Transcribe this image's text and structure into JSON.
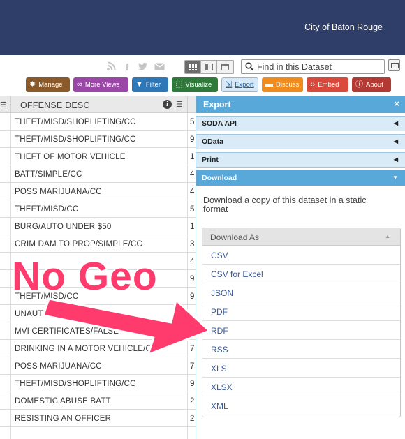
{
  "header": {
    "site_name": "City of Baton Rouge"
  },
  "toolbar": {
    "social": [
      "rss-icon",
      "facebook-icon",
      "twitter-icon",
      "email-icon"
    ],
    "search_placeholder": "Find in this Dataset",
    "buttons": {
      "manage": "Manage",
      "more_views": "More Views",
      "filter": "Filter",
      "visualize": "Visualize",
      "export": "Export",
      "discuss": "Discuss",
      "embed": "Embed",
      "about": "About"
    }
  },
  "table": {
    "column_header": "OFFENSE DESC",
    "rows": [
      {
        "offense": "THEFT/MISD/SHOPLIFTING/CC",
        "next": "5"
      },
      {
        "offense": "THEFT/MISD/SHOPLIFTING/CC",
        "next": "9"
      },
      {
        "offense": "THEFT OF MOTOR VEHICLE",
        "next": "1"
      },
      {
        "offense": "BATT/SIMPLE/CC",
        "next": "4"
      },
      {
        "offense": "POSS MARIJUANA/CC",
        "next": "4"
      },
      {
        "offense": "THEFT/MISD/CC",
        "next": "5"
      },
      {
        "offense": "BURG/AUTO UNDER $50",
        "next": "1"
      },
      {
        "offense": "CRIM DAM TO PROP/SIMPLE/CC",
        "next": "3"
      },
      {
        "offense": "",
        "next": "4"
      },
      {
        "offense": "",
        "next": "9"
      },
      {
        "offense": "THEFT/MISD/CC",
        "next": "9"
      },
      {
        "offense": "UNAUTH USE/MOVABLE",
        "next": ""
      },
      {
        "offense": "MVI CERTIFICATES/FALSE",
        "next": "7"
      },
      {
        "offense": "DRINKING IN A MOTOR VEHICLE/CC",
        "next": "7"
      },
      {
        "offense": "POSS MARIJUANA/CC",
        "next": "7"
      },
      {
        "offense": "THEFT/MISD/SHOPLIFTING/CC",
        "next": "9"
      },
      {
        "offense": "DOMESTIC ABUSE BATT",
        "next": "2"
      },
      {
        "offense": "RESISTING AN OFFICER",
        "next": "2"
      }
    ]
  },
  "export_panel": {
    "title": "Export",
    "close": "×",
    "sections": [
      "SODA API",
      "OData",
      "Print",
      "Download"
    ],
    "download_text": "Download a copy of this dataset in a static format",
    "download_as_label": "Download As",
    "formats": [
      "CSV",
      "CSV for Excel",
      "JSON",
      "PDF",
      "RDF",
      "RSS",
      "XLS",
      "XLSX",
      "XML"
    ]
  },
  "annotation": {
    "text": "No Geo",
    "color": "#ff3b6e"
  },
  "colors": {
    "header_bg": "#2f3d69",
    "panel_accent": "#58a9d9"
  }
}
